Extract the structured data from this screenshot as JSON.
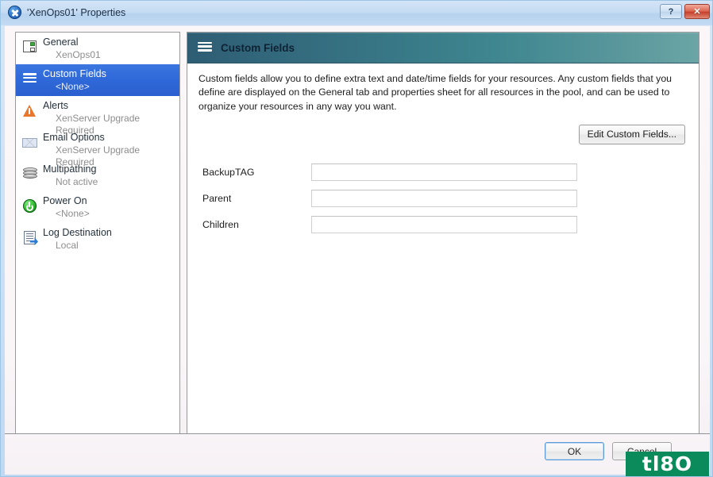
{
  "window": {
    "title": "'XenOps01' Properties",
    "icon": "xenserver-x-icon",
    "help_label": "?",
    "close_label": "✕"
  },
  "sidebar": {
    "items": [
      {
        "icon": "general-icon",
        "title": "General",
        "sub": "XenOps01",
        "selected": false
      },
      {
        "icon": "custom-fields-icon",
        "title": "Custom Fields",
        "sub": "<None>",
        "selected": true
      },
      {
        "icon": "alert-icon",
        "title": "Alerts",
        "sub": "XenServer Upgrade Required",
        "selected": false
      },
      {
        "icon": "mail-icon",
        "title": "Email Options",
        "sub": "XenServer Upgrade Required",
        "selected": false
      },
      {
        "icon": "disk-stack-icon",
        "title": "Multipathing",
        "sub": "Not active",
        "selected": false
      },
      {
        "icon": "power-icon",
        "title": "Power On",
        "sub": "<None>",
        "selected": false
      },
      {
        "icon": "log-destination-icon",
        "title": "Log Destination",
        "sub": "Local",
        "selected": false
      }
    ]
  },
  "content": {
    "header_icon": "custom-fields-icon",
    "title": "Custom Fields",
    "description": "Custom fields allow you to define extra text and date/time fields for your resources. Any custom fields that you define are displayed on the General tab and properties sheet for all resources in the pool, and can be used to organize your resources in any way you want.",
    "edit_button": "Edit Custom Fields...",
    "fields": [
      {
        "label": "BackupTAG",
        "value": "",
        "placeholder": ""
      },
      {
        "label": "Parent",
        "value": "",
        "placeholder": ""
      },
      {
        "label": "Children",
        "value": "",
        "placeholder": ""
      }
    ]
  },
  "footer": {
    "ok_label": "OK",
    "cancel_label": "Cancel"
  },
  "watermark": {
    "text": "tl8O",
    "color": "#0b8a5c"
  },
  "colors": {
    "selection_blue": "#2f68d8",
    "header_teal_dark": "#2e5d74",
    "header_teal_light": "#6ba5a6",
    "close_red": "#c7402c"
  }
}
